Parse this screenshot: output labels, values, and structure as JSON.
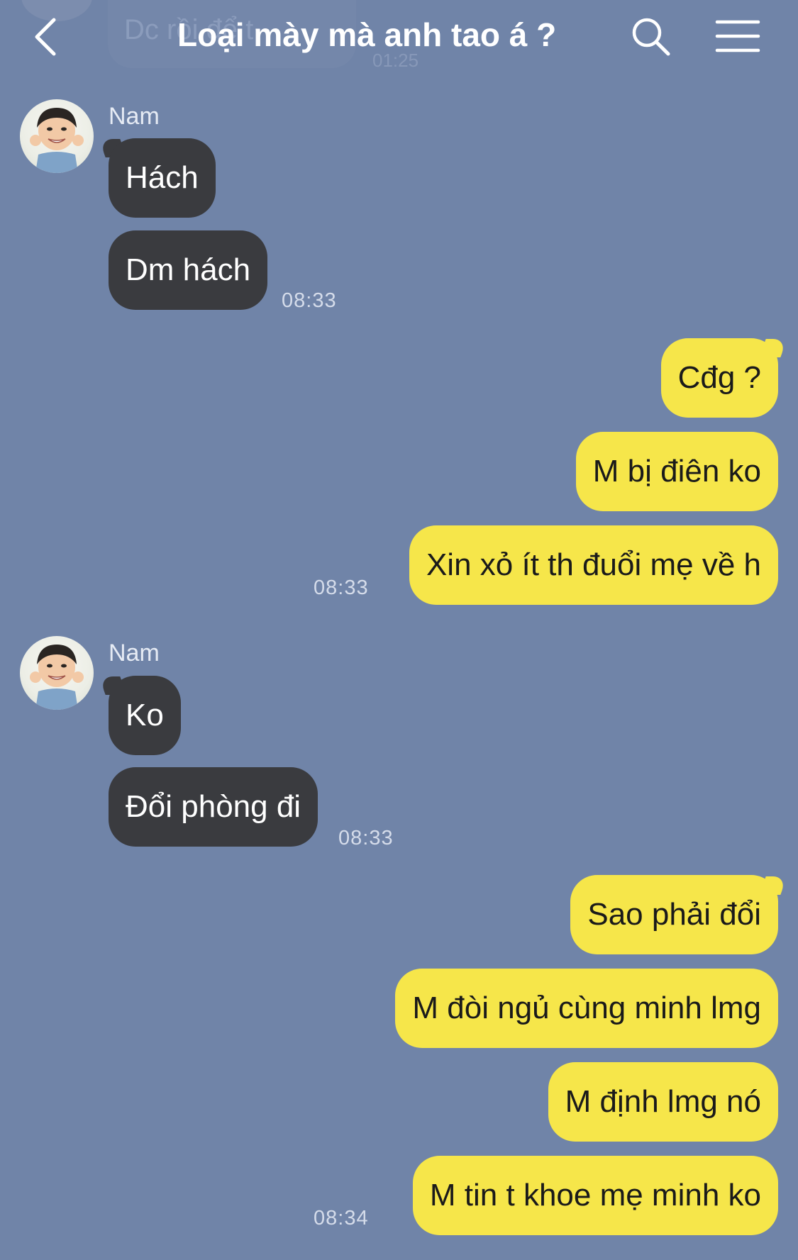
{
  "header": {
    "title": "Loại mày mà anh tao á ?",
    "ghost_text": "Dc rồi để t",
    "ghost_time": "01:25"
  },
  "messages": {
    "group1": {
      "sender": "Nam",
      "bubbles": [
        "Hách",
        "Dm hách"
      ],
      "time": "08:33"
    },
    "group2": {
      "bubbles": [
        "Cđg ?",
        "M bị điên ko",
        "Xin xỏ ít th đuổi mẹ về h"
      ],
      "time": "08:33"
    },
    "group3": {
      "sender": "Nam",
      "bubbles": [
        "Ko",
        "Đổi phòng đi"
      ],
      "time": "08:33"
    },
    "group4": {
      "bubbles": [
        "Sao phải đổi",
        "M đòi ngủ cùng minh lmg",
        "M định lmg nó",
        "M tin t khoe mẹ minh ko"
      ],
      "time": "08:34"
    }
  },
  "colors": {
    "background": "#7084a8",
    "incoming_bubble": "#3a3b3f",
    "outgoing_bubble": "#f6e64a"
  },
  "icons": {
    "back": "chevron-left-icon",
    "search": "search-icon",
    "menu": "hamburger-menu-icon"
  }
}
